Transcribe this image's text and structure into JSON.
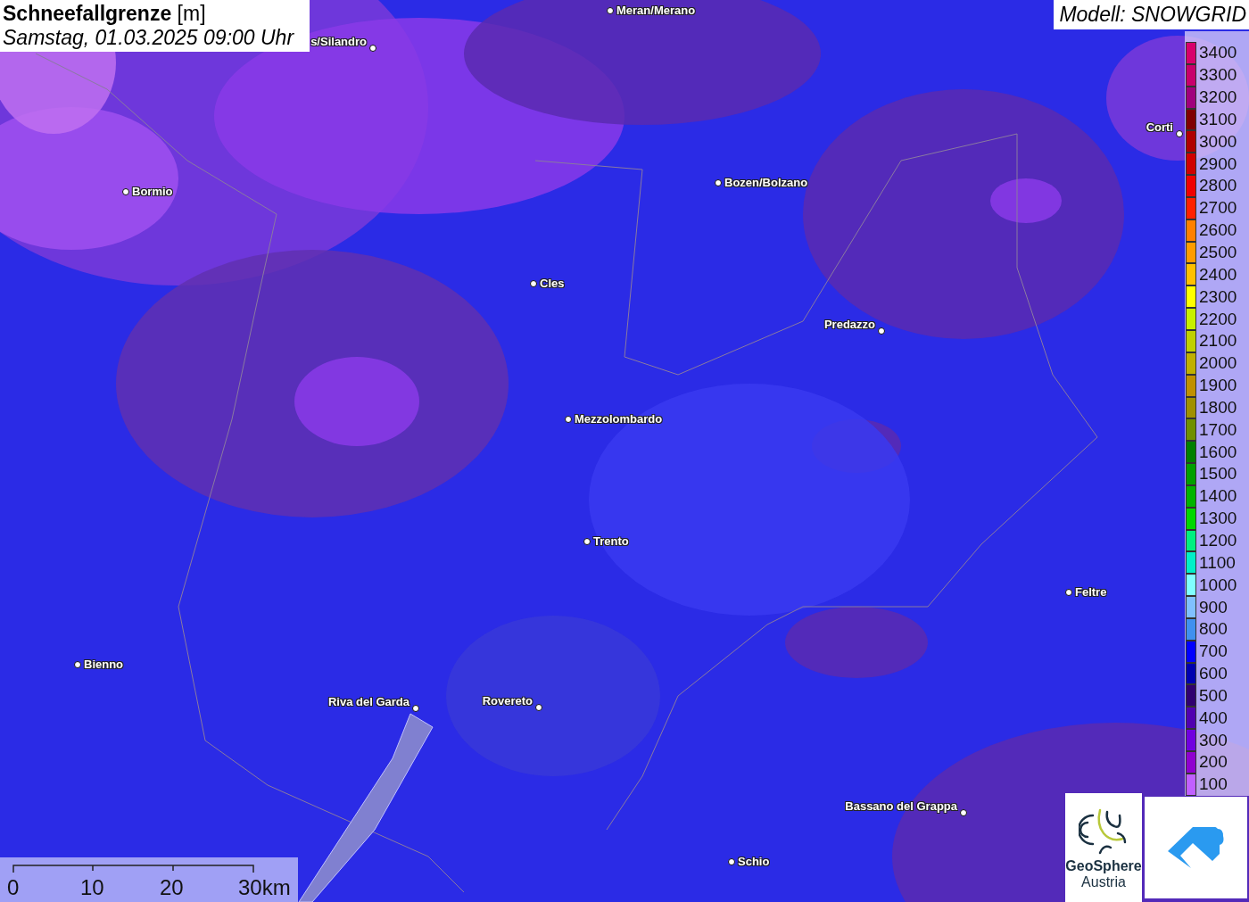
{
  "title": {
    "heading": "**Schneefallgrenze** [m]",
    "datetime": "Samstag, 01.03.2025 09:00 Uhr"
  },
  "model": "Modell: SNOWGRID",
  "cities": [
    {
      "name": "Meran/Merano"
    },
    {
      "name": "s/Silandro"
    },
    {
      "name": "Bormio"
    },
    {
      "name": "Bozen/Bolzano"
    },
    {
      "name": "Cles"
    },
    {
      "name": "Predazzo"
    },
    {
      "name": "Mezzolombardo"
    },
    {
      "name": "Trento"
    },
    {
      "name": "Feltre"
    },
    {
      "name": "Bienno"
    },
    {
      "name": "Riva del Garda"
    },
    {
      "name": "Rovereto"
    },
    {
      "name": "Bassano del Grappa"
    },
    {
      "name": "Schio"
    },
    {
      "name": "Corti"
    }
  ],
  "legend": [
    {
      "label": "3400",
      "color": "#d8006c"
    },
    {
      "label": "3300",
      "color": "#c8006c"
    },
    {
      "label": "3200",
      "color": "#a0007c"
    },
    {
      "label": "3100",
      "color": "#800000"
    },
    {
      "label": "3000",
      "color": "#b00000"
    },
    {
      "label": "2900",
      "color": "#d00000"
    },
    {
      "label": "2800",
      "color": "#f00000"
    },
    {
      "label": "2700",
      "color": "#ff2000"
    },
    {
      "label": "2600",
      "color": "#ff8000"
    },
    {
      "label": "2500",
      "color": "#ff9c00"
    },
    {
      "label": "2400",
      "color": "#ffc000"
    },
    {
      "label": "2300",
      "color": "#ffff00"
    },
    {
      "label": "2200",
      "color": "#c8f000"
    },
    {
      "label": "2100",
      "color": "#c0d000"
    },
    {
      "label": "2000",
      "color": "#c0b000"
    },
    {
      "label": "1900",
      "color": "#c09000"
    },
    {
      "label": "1800",
      "color": "#a09000"
    },
    {
      "label": "1700",
      "color": "#709000"
    },
    {
      "label": "1600",
      "color": "#008000"
    },
    {
      "label": "1500",
      "color": "#00a000"
    },
    {
      "label": "1400",
      "color": "#00b400"
    },
    {
      "label": "1300",
      "color": "#00d800"
    },
    {
      "label": "1200",
      "color": "#00f080"
    },
    {
      "label": "1100",
      "color": "#00f0c8"
    },
    {
      "label": "1000",
      "color": "#80ffff"
    },
    {
      "label": "900",
      "color": "#80c0ff"
    },
    {
      "label": "800",
      "color": "#4090f0"
    },
    {
      "label": "700",
      "color": "#0000ff"
    },
    {
      "label": "600",
      "color": "#0000b0"
    },
    {
      "label": "500",
      "color": "#300070"
    },
    {
      "label": "400",
      "color": "#5000b0"
    },
    {
      "label": "300",
      "color": "#7000e0"
    },
    {
      "label": "200",
      "color": "#9000d0"
    },
    {
      "label": "100",
      "color": "#c060ff"
    }
  ],
  "scale": [
    "0",
    "10",
    "20",
    "30km"
  ],
  "logo": {
    "name": "GeoSphere",
    "country": "Austria"
  }
}
